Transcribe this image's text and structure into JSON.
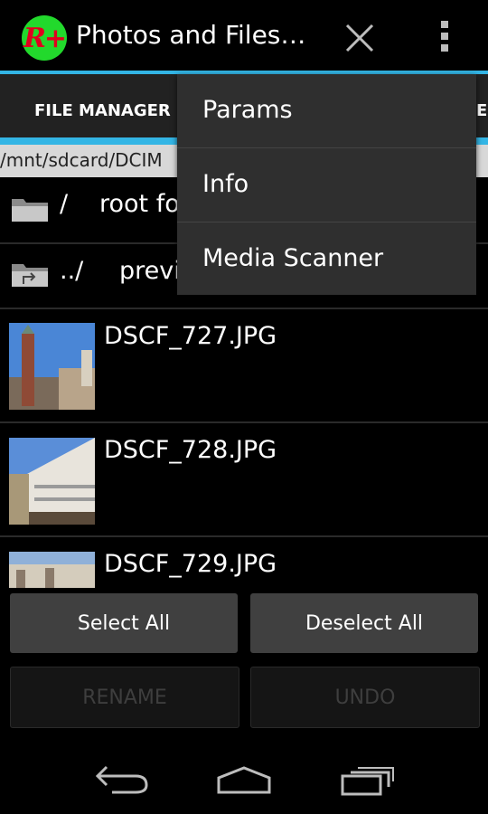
{
  "app": {
    "logo_text": "R+",
    "title": "Photos and Files…",
    "accent_color": "#33b5e5",
    "logo_color": "#22d92c"
  },
  "actions": {
    "close_icon": "close-icon",
    "overflow_icon": "overflow-menu-icon"
  },
  "tabs": {
    "active": "FILE MANAGER",
    "partial_next": "E"
  },
  "path": "/mnt/sdcard/DCIM",
  "list": {
    "root": {
      "name": "/",
      "desc": "root fo"
    },
    "parent": {
      "name": "../",
      "desc": "previ"
    },
    "files": [
      {
        "name": "DSCF_727.JPG"
      },
      {
        "name": "DSCF_728.JPG"
      },
      {
        "name": "DSCF_729.JPG"
      }
    ]
  },
  "menu": {
    "items": [
      "Params",
      "Info",
      "Media Scanner"
    ]
  },
  "buttons": {
    "select_all": "Select All",
    "deselect_all": "Deselect All",
    "rename": "RENAME",
    "undo": "UNDO"
  },
  "nav": {
    "back": "back-icon",
    "home": "home-icon",
    "recents": "recent-apps-icon"
  }
}
